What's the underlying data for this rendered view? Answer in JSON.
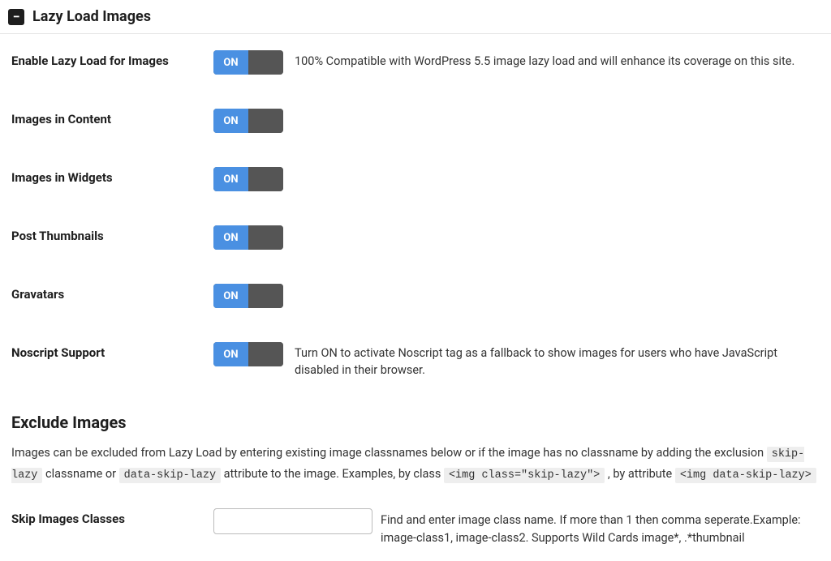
{
  "header": {
    "title": "Lazy Load Images"
  },
  "toggles": {
    "on_label": "ON",
    "enable": {
      "label": "Enable Lazy Load for Images",
      "desc": "100% Compatible with WordPress 5.5 image lazy load and will enhance its coverage on this site."
    },
    "content": {
      "label": "Images in Content"
    },
    "widgets": {
      "label": "Images in Widgets"
    },
    "thumbnails": {
      "label": "Post Thumbnails"
    },
    "gravatars": {
      "label": "Gravatars"
    },
    "noscript": {
      "label": "Noscript Support",
      "desc": "Turn ON to activate Noscript tag as a fallback to show images for users who have JavaScript disabled in their browser."
    }
  },
  "exclude": {
    "heading": "Exclude Images",
    "desc_1": "Images can be excluded from Lazy Load by entering existing image classnames below or if the image has no classname by adding the exclusion ",
    "code_1": "skip-lazy",
    "desc_2": " classname or ",
    "code_2": "data-skip-lazy",
    "desc_3": " attribute to the image. Examples, by class ",
    "code_3": "<img class=\"skip-lazy\">",
    "desc_4": " , by attribute ",
    "code_4": "<img data-skip-lazy>",
    "skip_label": "Skip Images Classes",
    "skip_desc": "Find and enter image class name. If more than 1 then comma seperate.Example: image-class1, image-class2. Supports Wild Cards image*, .*thumbnail"
  }
}
